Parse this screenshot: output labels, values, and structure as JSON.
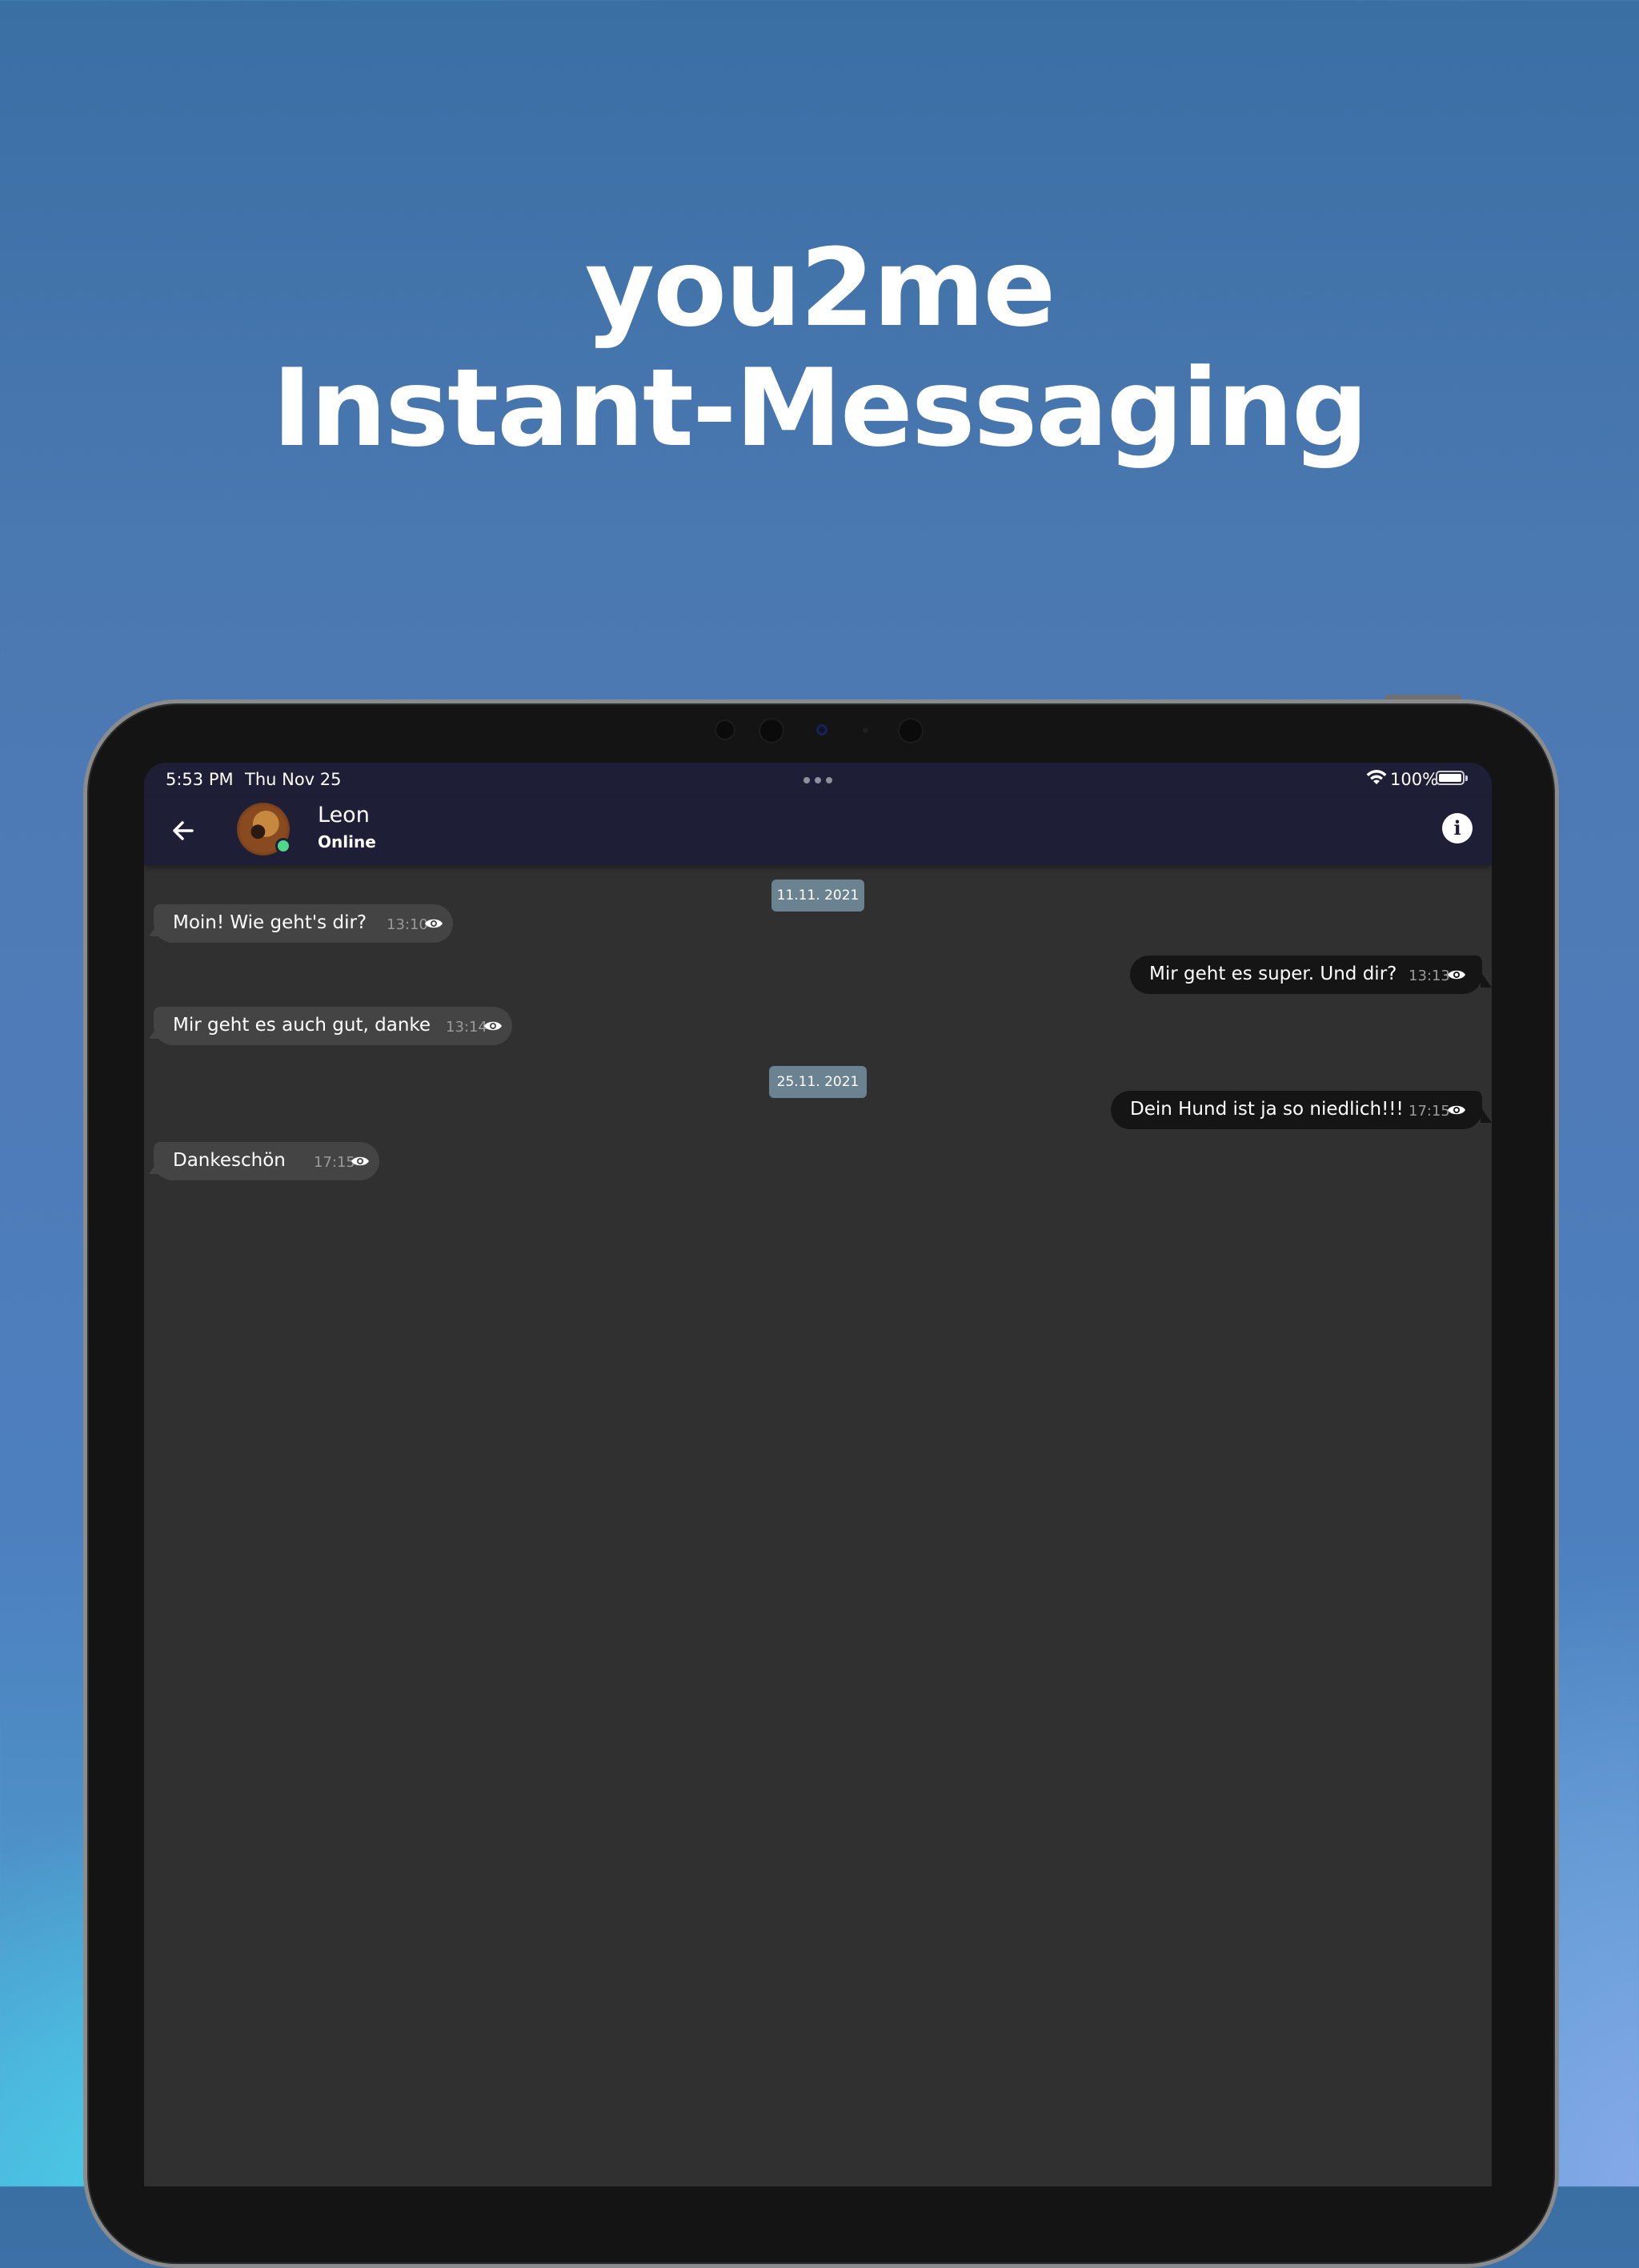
{
  "headline": {
    "line1": "you2me",
    "line2": "Instant-Messaging"
  },
  "status_bar": {
    "time": "5:53 PM",
    "date": "Thu Nov 25",
    "battery": "100%"
  },
  "header": {
    "contact_name": "Leon",
    "contact_status": "Online"
  },
  "messages": [
    {
      "kind": "date",
      "text": "11.11. 2021"
    },
    {
      "kind": "in",
      "text": "Moin! Wie geht's dir?",
      "time": "13:10"
    },
    {
      "kind": "out",
      "text": "Mir geht es super. Und dir?",
      "time": "13:13"
    },
    {
      "kind": "in",
      "text": "Mir geht es auch gut, danke",
      "time": "13:14"
    },
    {
      "kind": "date",
      "text": "25.11. 2021"
    },
    {
      "kind": "out",
      "text": "Dein Hund ist ja so niedlich!!!",
      "time": "17:15"
    },
    {
      "kind": "in",
      "text": "Dankeschön",
      "time": "17:15"
    }
  ],
  "colors": {
    "appbar": "#1e1e36",
    "chat_background": "#303030",
    "incoming_bubble": "#444444",
    "outgoing_bubble": "#151515",
    "date_chip": "#6b8391",
    "online": "#4fd88a"
  }
}
